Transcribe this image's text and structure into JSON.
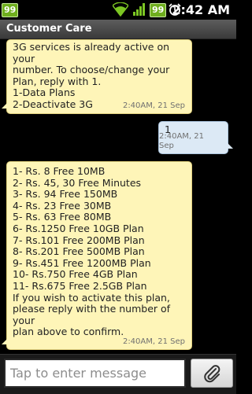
{
  "status_bar": {
    "left_badge": "99",
    "right_badge": "99",
    "time": "2:42 AM",
    "icons": [
      "wifi-icon",
      "signal-icon",
      "battery-icon",
      "alarm-clock-icon"
    ]
  },
  "header": {
    "title": "Customer Care"
  },
  "messages": [
    {
      "direction": "incoming",
      "text": "3G services is already active on your\nnumber. To choose/change your\nPlan, reply with 1.\n1-Data Plans\n2-Deactivate 3G",
      "time": "2:40AM, 21 Sep"
    },
    {
      "direction": "outgoing",
      "text": "1",
      "time": "2:40AM, 21 Sep"
    },
    {
      "direction": "incoming",
      "text": "1- Rs. 8 Free 10MB\n2- Rs. 45, 30 Free Minutes\n3- Rs. 94 Free 150MB\n4- Rs. 23 Free 30MB\n5- Rs. 63 Free 80MB\n6- Rs.1250 Free 10GB Plan\n7- Rs.101 Free 200MB Plan\n8- Rs.201 Free 500MB Plan\n9- Rs.451 Free 1200MB Plan\n10- Rs.750 Free 4GB Plan\n11- Rs.675 Free 2.5GB Plan\nIf you wish to activate this plan,\nplease reply with the number of your\nplan above to confirm.",
      "time": "2:40AM, 21 Sep"
    }
  ],
  "compose": {
    "placeholder": "Tap to enter message",
    "value": "",
    "attach_icon": "paperclip-icon"
  },
  "colors": {
    "incoming_bubble": "#fef5b8",
    "outgoing_bubble": "#dce9f5",
    "status_badge": "#6fae1e"
  }
}
